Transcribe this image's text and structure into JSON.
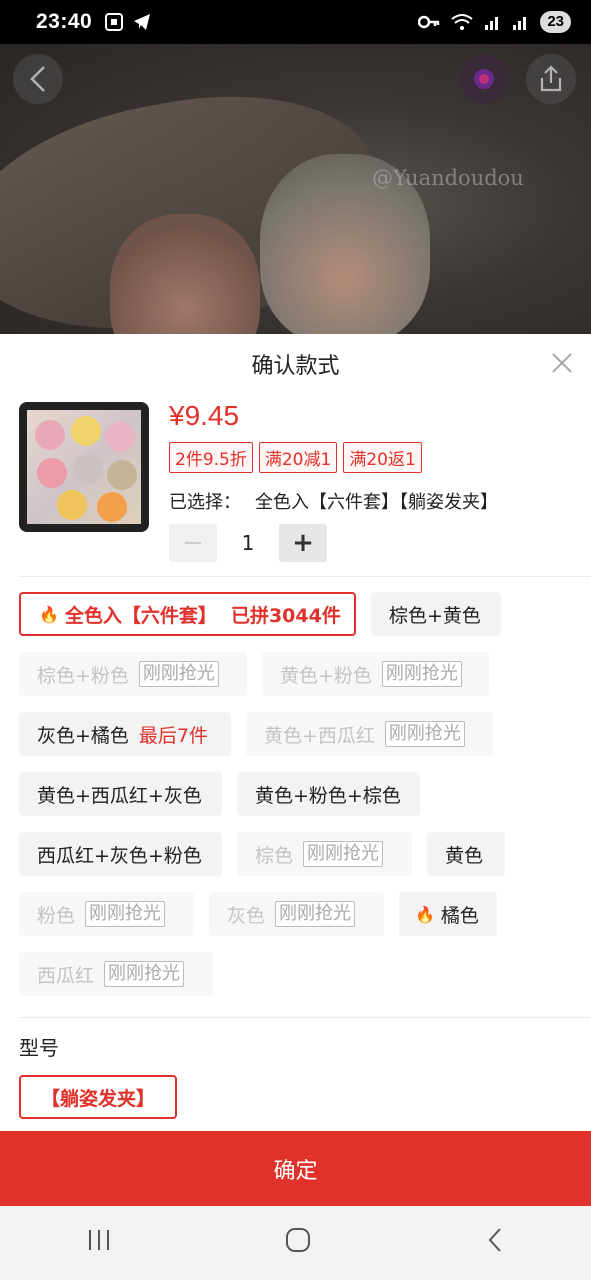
{
  "status_bar": {
    "time": "23:40",
    "battery": "23"
  },
  "hero": {
    "watermark": "@Yuandoudou"
  },
  "sheet": {
    "title": "确认款式",
    "price": "¥9.45",
    "promos": [
      "2件9.5折",
      "满20减1",
      "满20返1"
    ],
    "selected_label": "已选择：",
    "selected_value": "全色入【六件套】【躺姿发夹】",
    "quantity": "1",
    "qty_minus": "−",
    "qty_plus": "+"
  },
  "options": {
    "opt0": {
      "label": "全色入【六件套】",
      "extra": "已拼3044件"
    },
    "opt1": {
      "label": "棕色+黄色"
    },
    "opt2": {
      "label": "棕色+粉色",
      "tag": "刚刚抢光"
    },
    "opt3": {
      "label": "黄色+粉色",
      "tag": "刚刚抢光"
    },
    "opt4": {
      "label": "灰色+橘色",
      "extra": "最后7件"
    },
    "opt5": {
      "label": "黄色+西瓜红",
      "tag": "刚刚抢光"
    },
    "opt6": {
      "label": "黄色+西瓜红+灰色"
    },
    "opt7": {
      "label": "黄色+粉色+棕色"
    },
    "opt8": {
      "label": "西瓜红+灰色+粉色"
    },
    "opt9": {
      "label": "棕色",
      "tag": "刚刚抢光"
    },
    "opt10": {
      "label": "黄色"
    },
    "opt11": {
      "label": "粉色",
      "tag": "刚刚抢光"
    },
    "opt12": {
      "label": "灰色",
      "tag": "刚刚抢光"
    },
    "opt13": {
      "label": "橘色"
    },
    "opt14": {
      "label": "西瓜红",
      "tag": "刚刚抢光"
    }
  },
  "model_section": {
    "title": "型号",
    "option": "【躺姿发夹】"
  },
  "confirm_label": "确定",
  "colors": {
    "accent": "#e0312a"
  }
}
